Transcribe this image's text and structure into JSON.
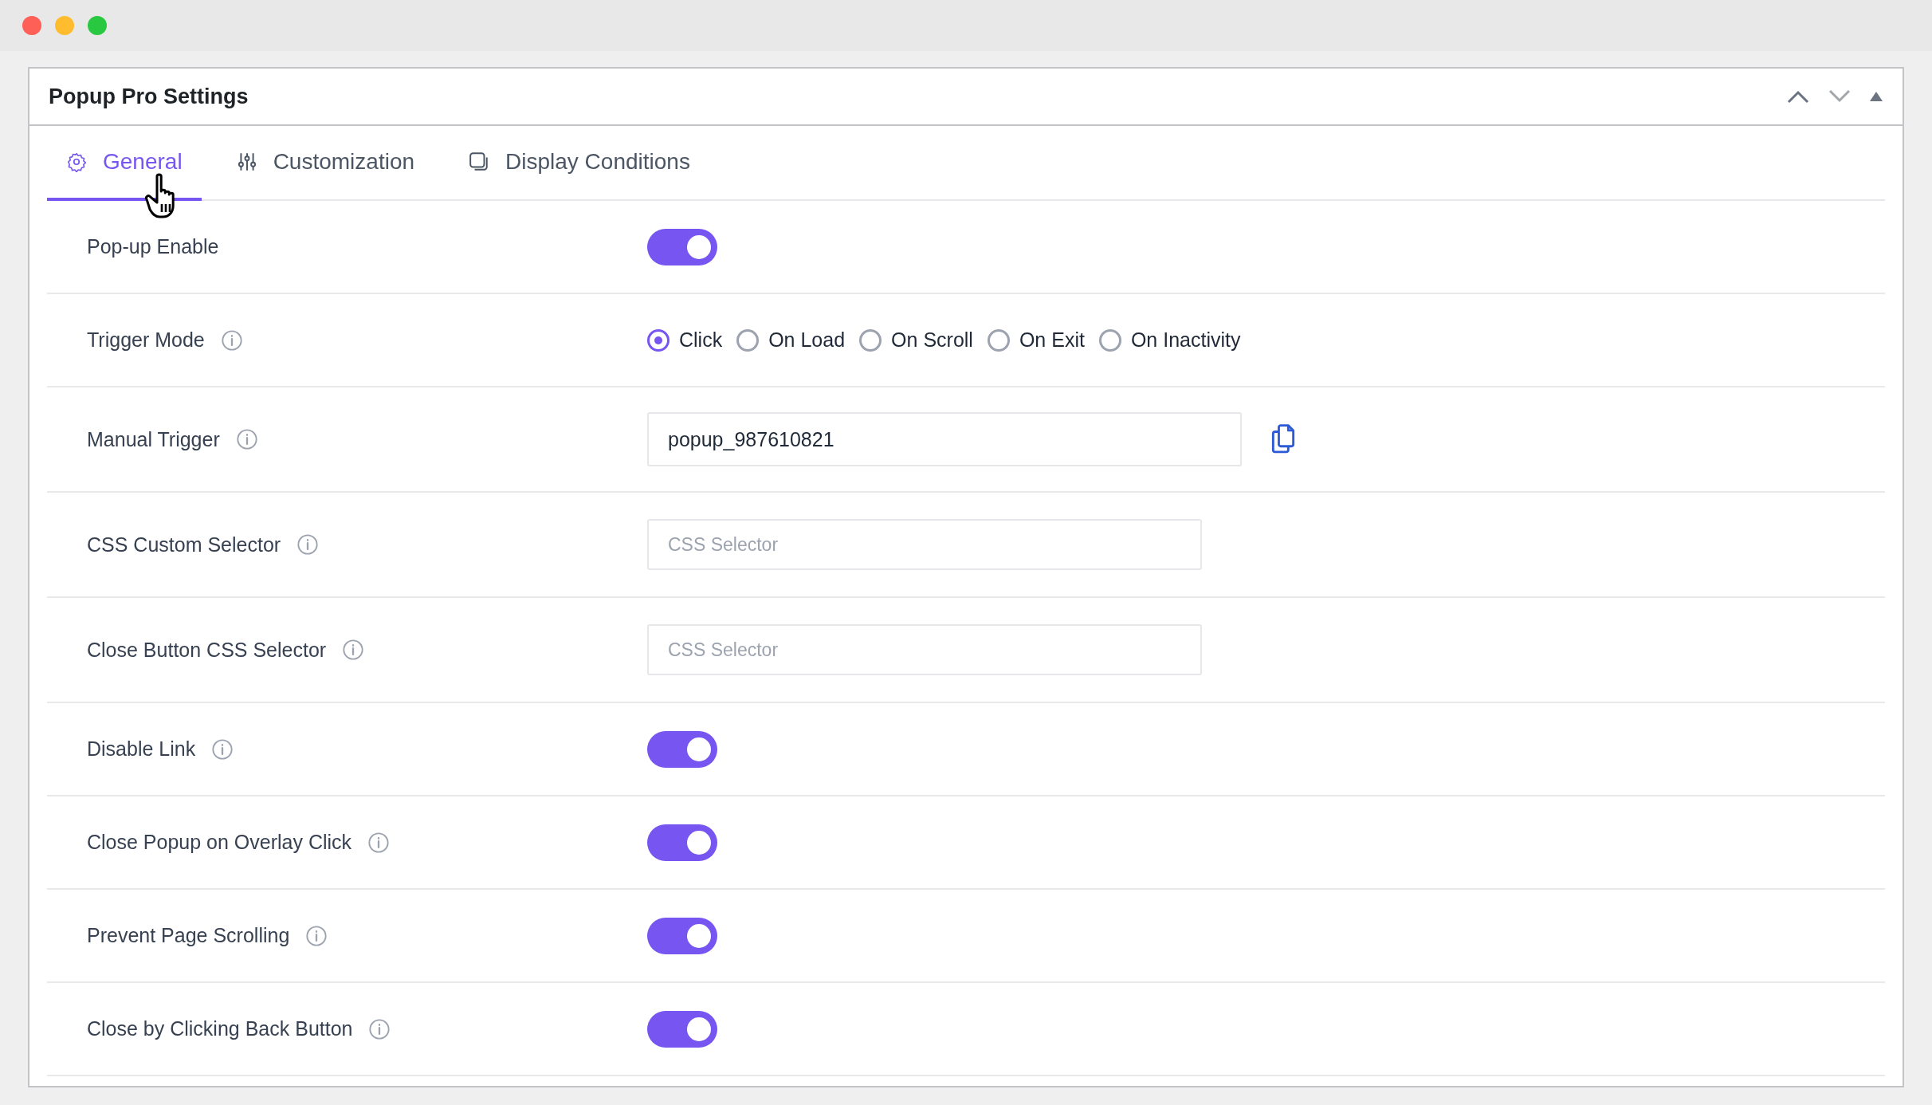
{
  "window": {
    "title": "Popup Pro Settings"
  },
  "tabs": [
    {
      "label": "General",
      "selected": true
    },
    {
      "label": "Customization",
      "selected": false
    },
    {
      "label": "Display Conditions",
      "selected": false
    }
  ],
  "settings": [
    {
      "label": "Pop-up Enable",
      "kind": "toggle",
      "info": false,
      "on": true
    },
    {
      "label": "Trigger Mode",
      "kind": "radio",
      "info": true,
      "options": [
        {
          "label": "Click",
          "selected": true
        },
        {
          "label": "On Load",
          "selected": false
        },
        {
          "label": "On Scroll",
          "selected": false
        },
        {
          "label": "On Exit",
          "selected": false
        },
        {
          "label": "On Inactivity",
          "selected": false
        }
      ]
    },
    {
      "label": "Manual Trigger",
      "kind": "text",
      "info": true,
      "value": "popup_987610821"
    },
    {
      "label": "CSS Custom Selector",
      "kind": "input",
      "info": true,
      "placeholder": "CSS Selector"
    },
    {
      "label": "Close Button CSS Selector",
      "kind": "input",
      "info": true,
      "placeholder": "CSS Selector"
    },
    {
      "label": "Disable Link",
      "kind": "toggle",
      "info": true,
      "on": true
    },
    {
      "label": "Close Popup on Overlay Click",
      "kind": "toggle",
      "info": true,
      "on": true
    },
    {
      "label": "Prevent Page Scrolling",
      "kind": "toggle",
      "info": true,
      "on": true
    },
    {
      "label": "Close by Clicking Back Button",
      "kind": "toggle",
      "info": true,
      "on": true
    }
  ]
}
